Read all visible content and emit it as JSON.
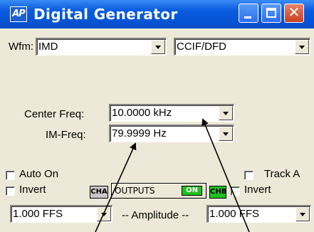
{
  "window": {
    "title": "Digital Generator",
    "app_icon_text": "AP"
  },
  "waveform": {
    "label": "Wfm:",
    "type_value": "IMD",
    "mode_value": "CCIF/DFD"
  },
  "center_freq": {
    "label": "Center Freq:",
    "value": "10.0000 kHz"
  },
  "im_freq": {
    "label": "IM-Freq:",
    "value": "79.9999  Hz"
  },
  "options_left": {
    "auto_on_label": "Auto On",
    "invert_label": "Invert"
  },
  "options_right": {
    "track_a_label": "Track A",
    "invert_label": "Invert"
  },
  "channels": {
    "cha_label": "CHA",
    "chb_label": "CHB",
    "chb_color": "#22c022"
  },
  "outputs": {
    "label": "OUTPUTS",
    "state": "ON",
    "on_color": "#22c022"
  },
  "amplitude": {
    "label": "-- Amplitude --",
    "left_value": "1.000   FFS",
    "right_value": "1.000   FFS"
  },
  "colors": {
    "titlebar": "#0554d7",
    "close_button": "#c8401f",
    "panel": "#ece9d8"
  }
}
